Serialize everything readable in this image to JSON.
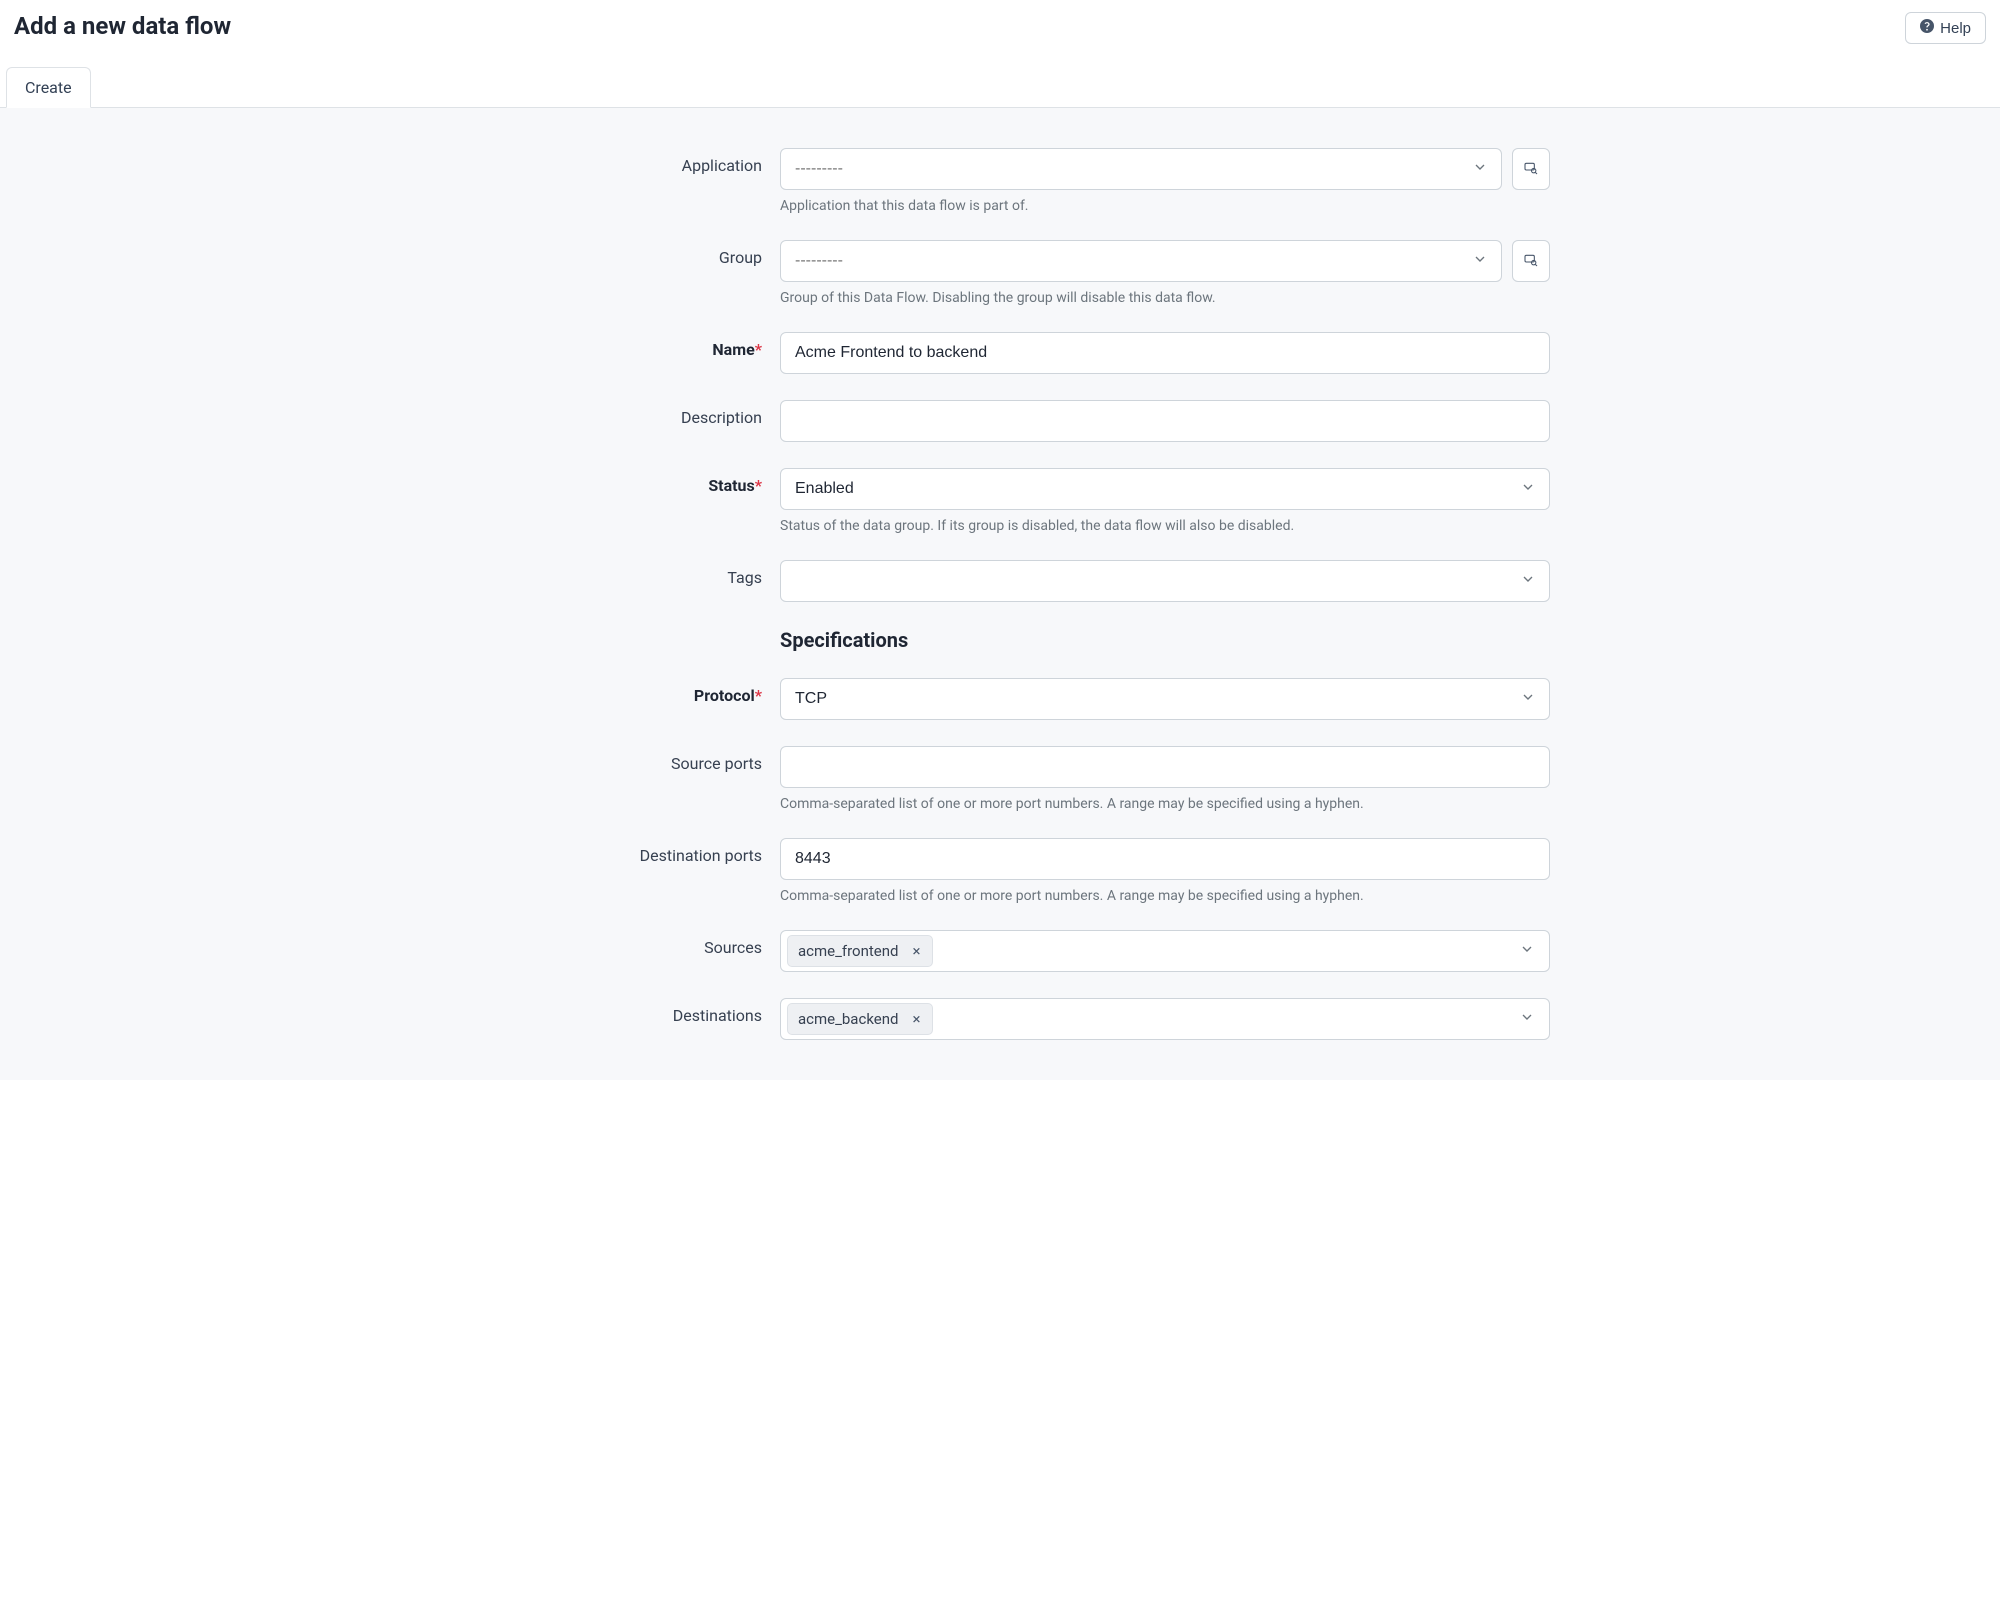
{
  "header": {
    "title": "Add a new data flow",
    "help_label": "Help"
  },
  "tabs": {
    "create": "Create"
  },
  "form": {
    "application": {
      "label": "Application",
      "placeholder": "---------",
      "help": "Application that this data flow is part of."
    },
    "group": {
      "label": "Group",
      "placeholder": "---------",
      "help": "Group of this Data Flow. Disabling the group will disable this data flow."
    },
    "name": {
      "label": "Name",
      "value": "Acme Frontend to backend"
    },
    "description": {
      "label": "Description",
      "value": ""
    },
    "status": {
      "label": "Status",
      "value": "Enabled",
      "help": "Status of the data group. If its group is disabled, the data flow will also be disabled."
    },
    "tags": {
      "label": "Tags"
    },
    "specs_heading": "Specifications",
    "protocol": {
      "label": "Protocol",
      "value": "TCP"
    },
    "source_ports": {
      "label": "Source ports",
      "value": "",
      "help": "Comma-separated list of one or more port numbers. A range may be specified using a hyphen."
    },
    "destination_ports": {
      "label": "Destination ports",
      "value": "8443",
      "help": "Comma-separated list of one or more port numbers. A range may be specified using a hyphen."
    },
    "sources": {
      "label": "Sources",
      "chips": [
        "acme_frontend"
      ]
    },
    "destinations": {
      "label": "Destinations",
      "chips": [
        "acme_backend"
      ]
    }
  }
}
